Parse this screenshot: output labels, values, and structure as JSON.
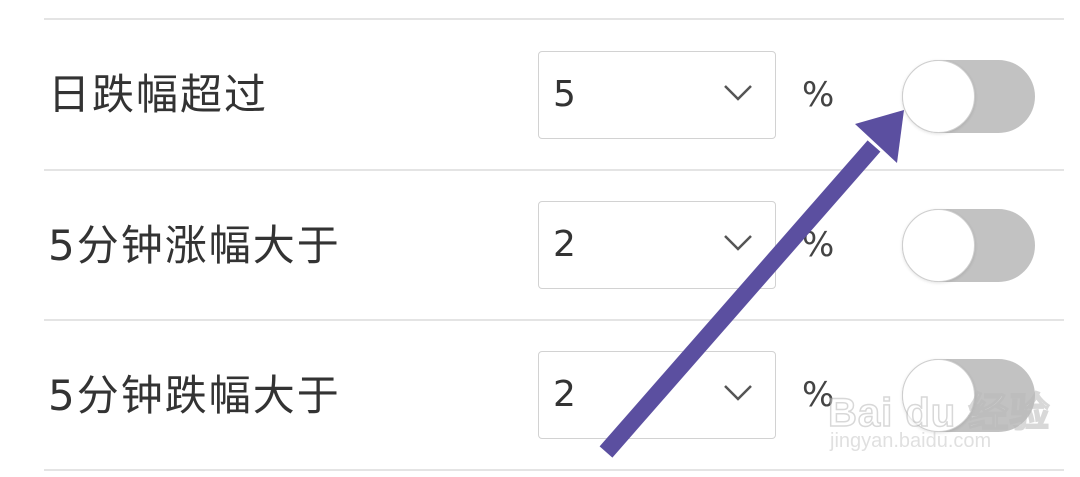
{
  "rows": [
    {
      "label": "日跌幅超过",
      "value": "5",
      "unit": "%",
      "toggle_on": false
    },
    {
      "label": "5分钟涨幅大于",
      "value": "2",
      "unit": "%",
      "toggle_on": false
    },
    {
      "label": "5分钟跌幅大于",
      "value": "2",
      "unit": "%",
      "toggle_on": false
    }
  ],
  "watermark": {
    "logo_text": "Bai du 经验",
    "url": "jingyan.baidu.com"
  },
  "colors": {
    "arrow": "#5b4fa0",
    "toggle_off": "#c2c2c2",
    "divider": "#e4e4e4",
    "text": "#333333"
  },
  "icons": {
    "dropdown": "chevron-down-icon",
    "annotation": "arrow-annotation"
  }
}
